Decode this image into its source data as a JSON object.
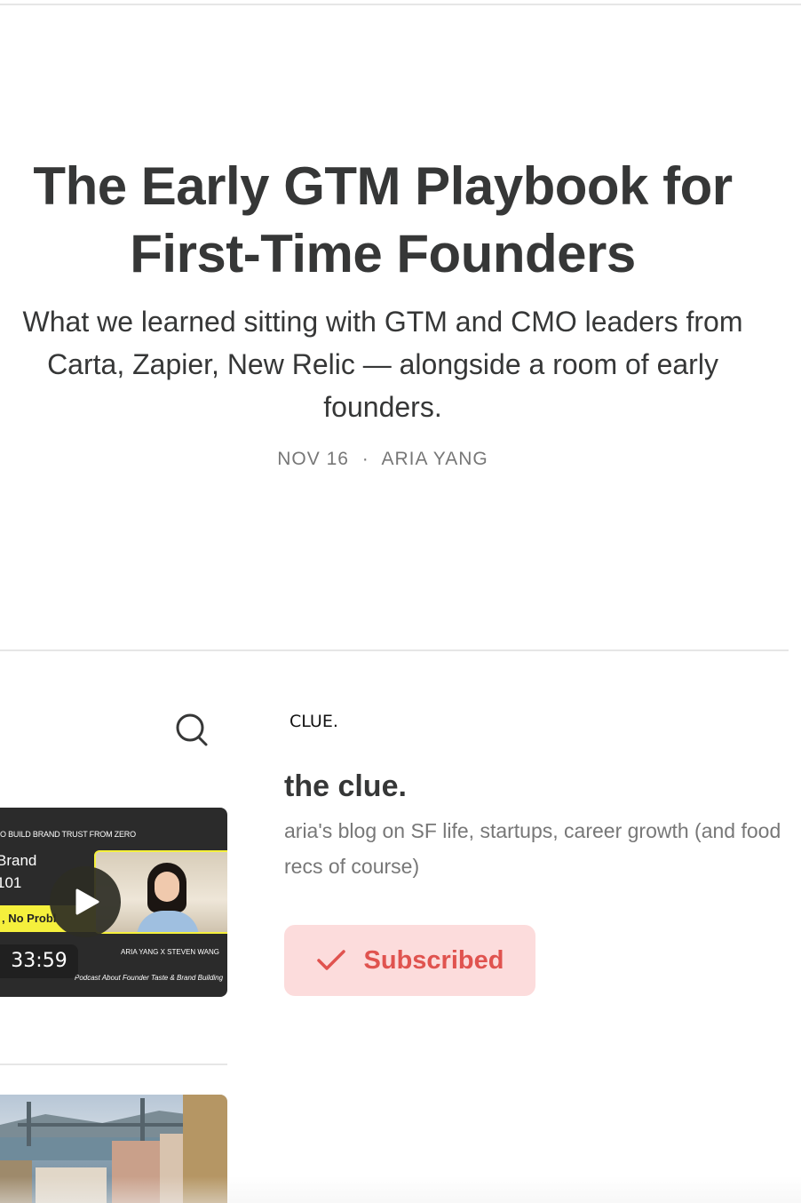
{
  "post": {
    "title": "The Early GTM Playbook for First-Time Founders",
    "subtitle": "What we learned sitting with GTM and CMO leaders from Carta, Zapier, New Relic — alongside a room of early founders.",
    "date": "NOV 16",
    "separator": "·",
    "author": "ARIA YANG"
  },
  "sidebar": {
    "search_icon": "search-icon",
    "video_card": {
      "kicker": "O BUILD BRAND TRUST FROM ZERO",
      "title_line1": "Brand",
      "title_line2": "101",
      "highlight": ", No Probl",
      "credit": "ARIA YANG X STEVEN WANG",
      "tagline": "Podcast About Founder Taste & Brand Building",
      "duration": "33:59",
      "play_icon": "play-icon"
    },
    "photo_card": {}
  },
  "publication": {
    "logo_text": "CLUE.",
    "name": "the clue.",
    "description": "aria's blog on SF life, startups, career growth (and food recs of course)",
    "subscribe_label": "Subscribed",
    "subscribe_icon": "checkmark-icon"
  },
  "colors": {
    "text": "#363737",
    "muted": "#777777",
    "accent": "#e0534f",
    "accent_bg": "#fcdcdc"
  }
}
